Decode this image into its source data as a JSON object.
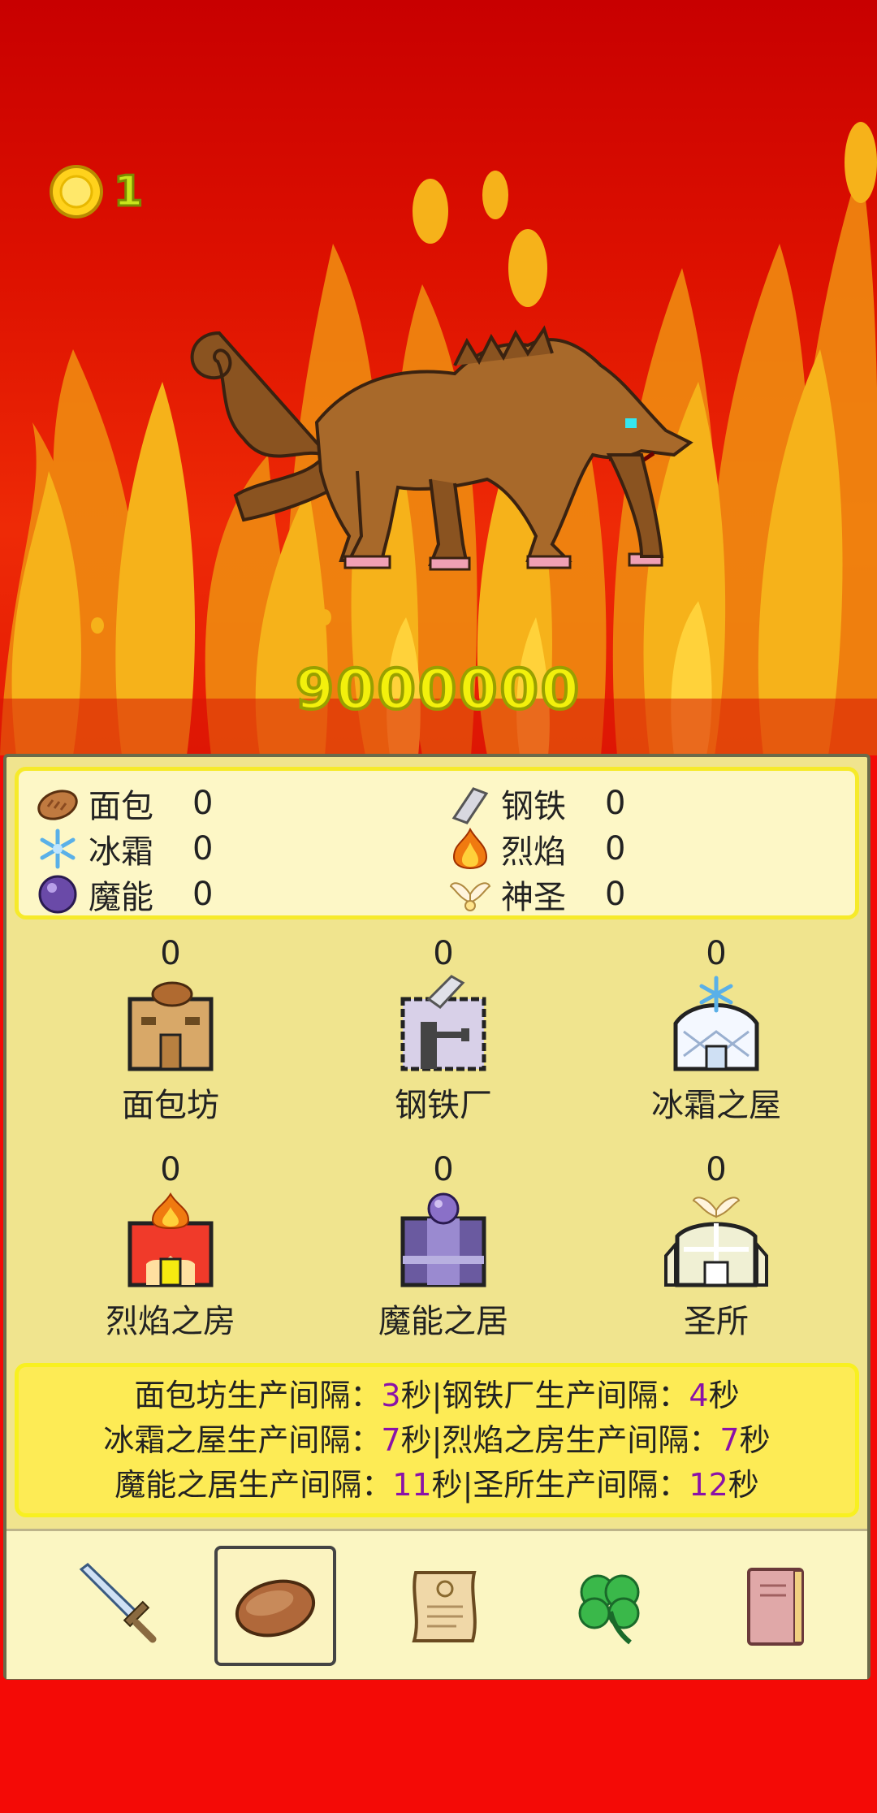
{
  "hud": {
    "coin_count": "1",
    "enemy_hp": "9000000"
  },
  "resources": [
    {
      "name": "面包",
      "value": "0",
      "icon": "bread-icon"
    },
    {
      "name": "钢铁",
      "value": "0",
      "icon": "steel-icon"
    },
    {
      "name": "冰霜",
      "value": "0",
      "icon": "frost-icon"
    },
    {
      "name": "烈焰",
      "value": "0",
      "icon": "flame-icon"
    },
    {
      "name": "魔能",
      "value": "0",
      "icon": "magic-orb-icon"
    },
    {
      "name": "神圣",
      "value": "0",
      "icon": "holy-wings-icon"
    }
  ],
  "buildings": [
    {
      "name": "面包坊",
      "count": "0"
    },
    {
      "name": "钢铁厂",
      "count": "0"
    },
    {
      "name": "冰霜之屋",
      "count": "0"
    },
    {
      "name": "烈焰之房",
      "count": "0"
    },
    {
      "name": "魔能之居",
      "count": "0"
    },
    {
      "name": "圣所",
      "count": "0"
    }
  ],
  "intervals": {
    "l1a": "面包坊生产间隔：",
    "l1a_v": "3",
    "l1b": "秒|钢铁厂生产间隔：",
    "l1b_v": "4",
    "l1c": "秒",
    "l2a": "冰霜之屋生产间隔：",
    "l2a_v": "7",
    "l2b": "秒|烈焰之房生产间隔：",
    "l2b_v": "7",
    "l2c": "秒",
    "l3a": "魔能之居生产间隔：",
    "l3a_v": "11",
    "l3b": "秒|圣所生产间隔：",
    "l3b_v": "12",
    "l3c": "秒"
  },
  "tabs": [
    {
      "icon": "sword-icon",
      "selected": false
    },
    {
      "icon": "bread-icon",
      "selected": true
    },
    {
      "icon": "scroll-icon",
      "selected": false
    },
    {
      "icon": "clover-icon",
      "selected": false
    },
    {
      "icon": "book-icon",
      "selected": false
    }
  ],
  "colors": {
    "accent_value": "#8a12a8",
    "panel": "#f0e48e",
    "hp_text": "#f3f00c"
  }
}
